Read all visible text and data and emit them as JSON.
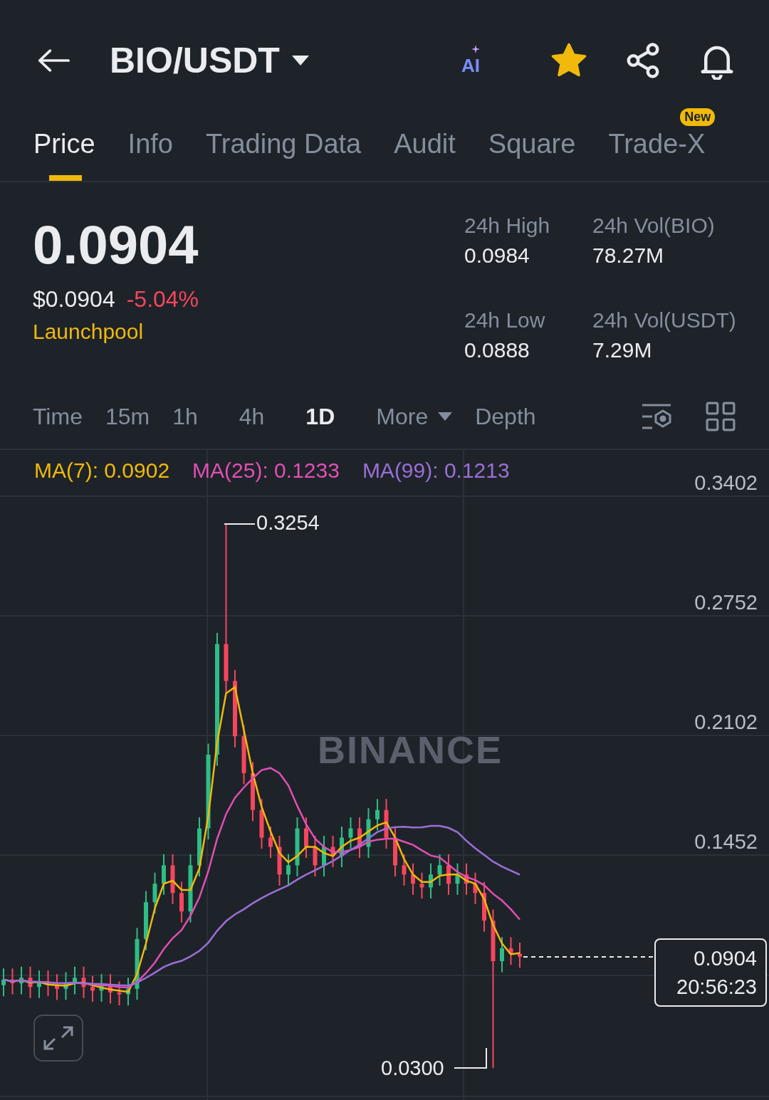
{
  "header": {
    "pair": "BIO/USDT",
    "ai_badge": "AI",
    "favorite": true
  },
  "tabs": [
    {
      "label": "Price",
      "selected": true
    },
    {
      "label": "Info",
      "selected": false
    },
    {
      "label": "Trading Data",
      "selected": false
    },
    {
      "label": "Audit",
      "selected": false
    },
    {
      "label": "Square",
      "selected": false
    },
    {
      "label": "Trade-X",
      "selected": false,
      "badge": "New"
    }
  ],
  "price": {
    "last": "0.0904",
    "usd": "$0.0904",
    "change": "-5.04%",
    "tag": "Launchpool"
  },
  "stats": [
    {
      "label": "24h High",
      "value": "0.0984"
    },
    {
      "label": "24h Vol(BIO)",
      "value": "78.27M"
    },
    {
      "label": "24h Low",
      "value": "0.0888"
    },
    {
      "label": "24h Vol(USDT)",
      "value": "7.29M"
    }
  ],
  "intervals": [
    {
      "label": "Time",
      "selected": false
    },
    {
      "label": "15m",
      "selected": false
    },
    {
      "label": "1h",
      "selected": false
    },
    {
      "label": "4h",
      "selected": false
    },
    {
      "label": "1D",
      "selected": true
    },
    {
      "label": "More",
      "selected": false,
      "dropdown": true
    },
    {
      "label": "Depth",
      "selected": false
    }
  ],
  "chart": {
    "ma": [
      {
        "label": "MA(7): 0.0902",
        "color": "#f0b90b"
      },
      {
        "label": "MA(25): 0.1233",
        "color": "#e04fb5"
      },
      {
        "label": "MA(99): 0.1213",
        "color": "#9b6fd6"
      }
    ],
    "y_labels": [
      "0.3402",
      "0.2752",
      "0.2102",
      "0.1452"
    ],
    "high_label": "0.3254",
    "low_label": "0.0300",
    "last_price": "0.0904",
    "countdown": "20:56:23",
    "watermark": "BINANCE"
  }
}
